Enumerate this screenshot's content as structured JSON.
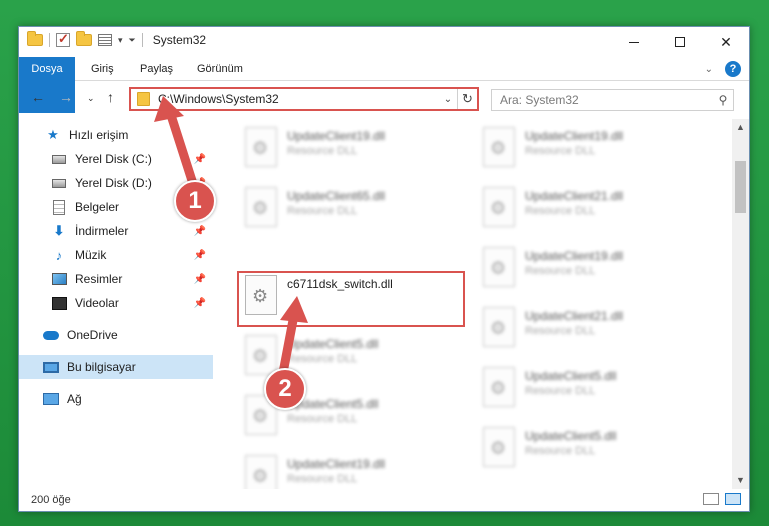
{
  "window": {
    "title": "System32"
  },
  "ribbon": {
    "tabs": [
      "Dosya",
      "Giriş",
      "Paylaş",
      "Görünüm"
    ],
    "help": "?"
  },
  "navbar": {
    "address": "C:\\Windows\\System32",
    "search_placeholder": "Ara: System32"
  },
  "sidebar": {
    "items": [
      {
        "label": "Hızlı erişim",
        "icon": "star-icon",
        "pinned": false
      },
      {
        "label": "Yerel Disk (C:)",
        "icon": "disk-icon",
        "pinned": true
      },
      {
        "label": "Yerel Disk (D:)",
        "icon": "disk-icon",
        "pinned": true
      },
      {
        "label": "Belgeler",
        "icon": "documents-icon",
        "pinned": true
      },
      {
        "label": "İndirmeler",
        "icon": "downloads-icon",
        "pinned": true
      },
      {
        "label": "Müzik",
        "icon": "music-icon",
        "pinned": true
      },
      {
        "label": "Resimler",
        "icon": "pictures-icon",
        "pinned": true
      },
      {
        "label": "Videolar",
        "icon": "videos-icon",
        "pinned": true
      },
      {
        "label": "OneDrive",
        "icon": "onedrive-icon",
        "pinned": false
      },
      {
        "label": "Bu bilgisayar",
        "icon": "this-pc-icon",
        "pinned": false,
        "selected": true
      },
      {
        "label": "Ağ",
        "icon": "network-icon",
        "pinned": false
      }
    ]
  },
  "files": {
    "left": [
      {
        "name": "UpdateClient19.dll",
        "type": "Resource DLL",
        "blurred": true
      },
      {
        "name": "UpdateClient65.dll",
        "type": "Resource DLL",
        "blurred": true
      },
      {
        "name": "c6711dsk_switch.dll",
        "type": "",
        "blurred": false,
        "highlighted": true
      },
      {
        "name": "UpdateClient5.dll",
        "type": "Resource DLL",
        "blurred": true
      },
      {
        "name": "UpdateClient5.dll",
        "type": "Resource DLL",
        "blurred": true
      },
      {
        "name": "UpdateClient19.dll",
        "type": "Resource DLL",
        "blurred": true
      }
    ],
    "right": [
      {
        "name": "UpdateClient19.dll",
        "type": "Resource DLL",
        "blurred": true
      },
      {
        "name": "UpdateClient21.dll",
        "type": "Resource DLL",
        "blurred": true
      },
      {
        "name": "UpdateClient19.dll",
        "type": "Resource DLL",
        "blurred": true
      },
      {
        "name": "UpdateClient21.dll",
        "type": "Resource DLL",
        "blurred": true
      },
      {
        "name": "UpdateClient5.dll",
        "type": "Resource DLL",
        "blurred": true
      },
      {
        "name": "UpdateClient5.dll",
        "type": "Resource DLL",
        "blurred": true
      }
    ]
  },
  "statusbar": {
    "count": "200 öğe"
  },
  "annotations": {
    "step1": "1",
    "step2": "2",
    "color": "#d9534f"
  },
  "colors": {
    "accent": "#1979ca",
    "selection": "#cce4f7",
    "background": "#1f8f3c"
  }
}
